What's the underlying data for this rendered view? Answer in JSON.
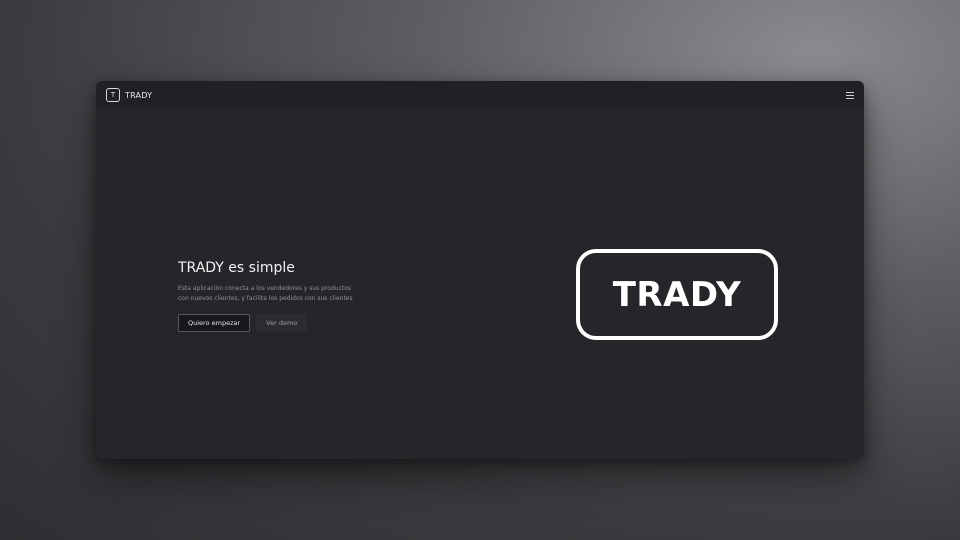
{
  "header": {
    "logo_letter": "T",
    "brand_name": "TRADY",
    "menu_icon": "hamburger-menu-icon"
  },
  "hero": {
    "title": "TRADY es simple",
    "description": "Esta aplicación conecta a los vendedores y sus productos con nuevos clientes, y facilita los pedidos con sus clientes",
    "primary_button": "Quiero empezar",
    "secondary_button": "Ver demo"
  },
  "logo": {
    "text": "TRADY"
  },
  "colors": {
    "window_bg": "#24262a",
    "topbar_bg": "#1f2124",
    "logo_stroke": "#ffffff"
  }
}
